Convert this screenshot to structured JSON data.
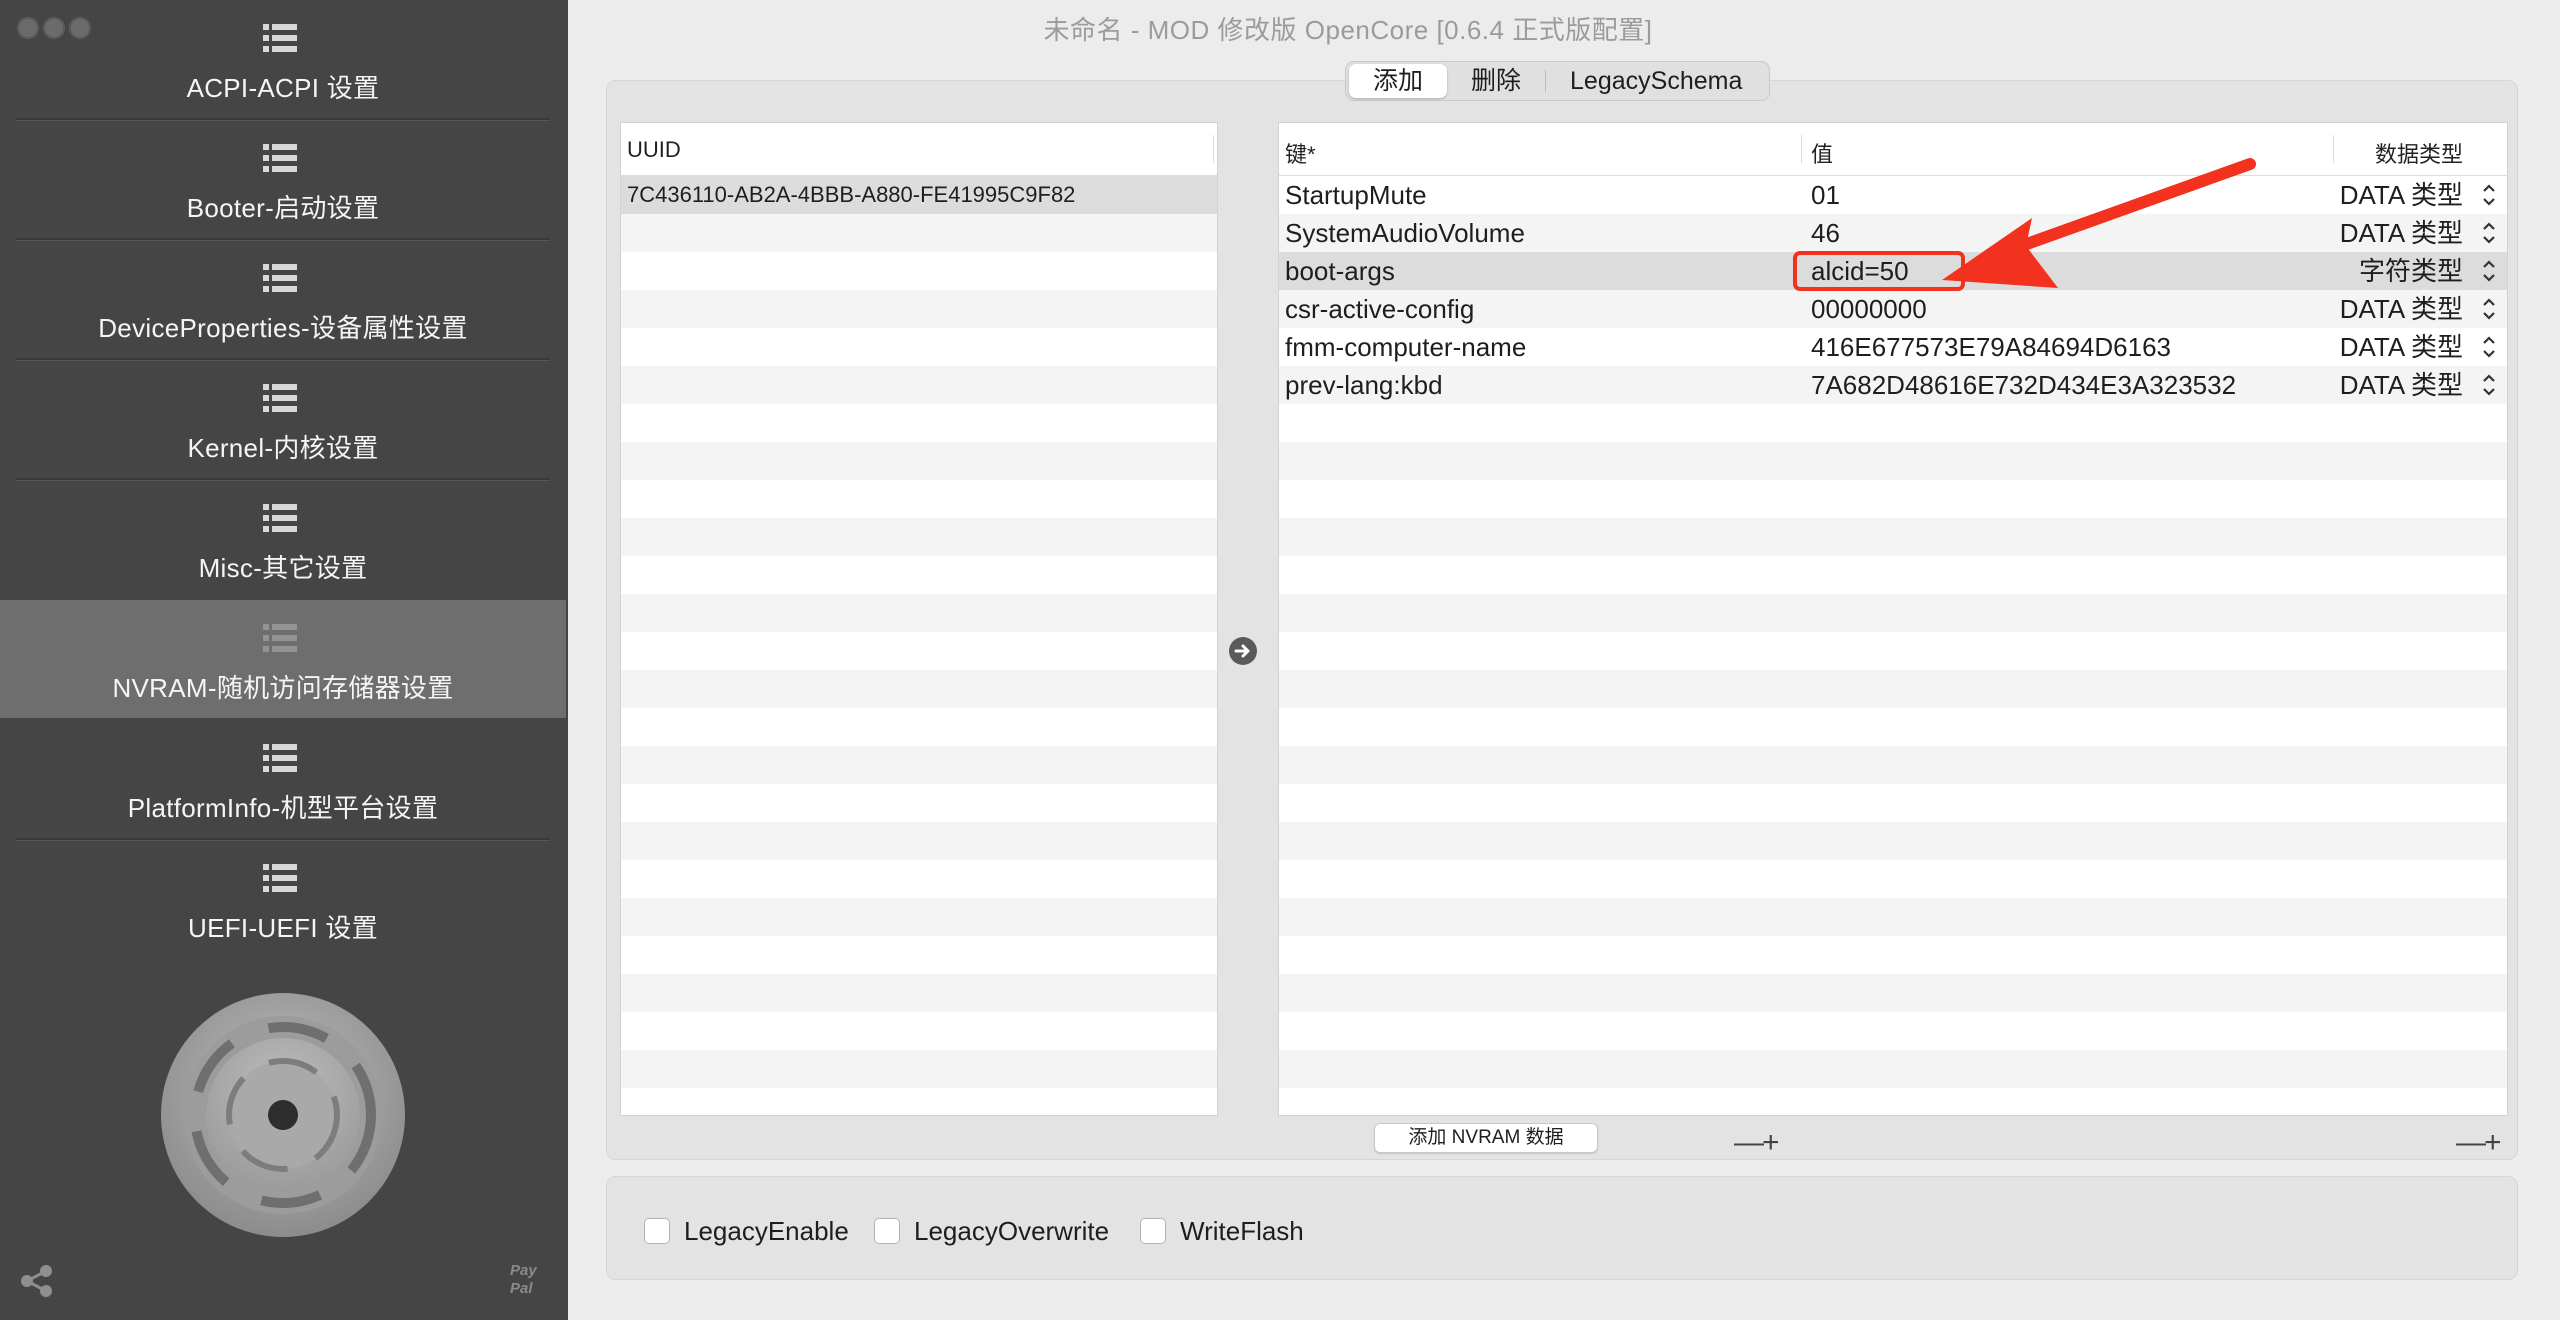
{
  "window": {
    "title": "未命名 - MOD 修改版 OpenCore [0.6.4 正式版配置]"
  },
  "sidebar": {
    "items": [
      {
        "label": "ACPI-ACPI 设置",
        "icon": "list-icon",
        "selected": false
      },
      {
        "label": "Booter-启动设置",
        "icon": "list-icon",
        "selected": false
      },
      {
        "label": "DeviceProperties-设备属性设置",
        "icon": "list-icon",
        "selected": false
      },
      {
        "label": "Kernel-内核设置",
        "icon": "list-icon",
        "selected": false
      },
      {
        "label": "Misc-其它设置",
        "icon": "list-icon",
        "selected": false
      },
      {
        "label": "NVRAM-随机访问存储器设置",
        "icon": "list-icon",
        "selected": true
      },
      {
        "label": "PlatformInfo-机型平台设置",
        "icon": "list-icon",
        "selected": false
      },
      {
        "label": "UEFI-UEFI 设置",
        "icon": "list-icon",
        "selected": false
      }
    ],
    "paypal": "Pay Pal"
  },
  "tabs": [
    {
      "label": "添加",
      "active": true
    },
    {
      "label": "删除",
      "active": false
    },
    {
      "label": "LegacySchema",
      "active": false
    }
  ],
  "uuid_table": {
    "header": "UUID",
    "rows": [
      "7C436110-AB2A-4BBB-A880-FE41995C9F82"
    ]
  },
  "nvram_table": {
    "headers": {
      "key": "键*",
      "value": "值",
      "type": "数据类型"
    },
    "rows": [
      {
        "key": "StartupMute",
        "value": "01",
        "type": "DATA 类型"
      },
      {
        "key": "SystemAudioVolume",
        "value": "46",
        "type": "DATA 类型"
      },
      {
        "key": "boot-args",
        "value": "alcid=50",
        "type": "字符类型"
      },
      {
        "key": "csr-active-config",
        "value": "00000000",
        "type": "DATA 类型"
      },
      {
        "key": "fmm-computer-name",
        "value": "416E677573E79A84694D6163",
        "type": "DATA 类型"
      },
      {
        "key": "prev-lang:kbd",
        "value": "7A682D48616E732D434E3A323532",
        "type": "DATA 类型"
      }
    ],
    "selected_row": 2
  },
  "buttons": {
    "add_nvram": "添加 NVRAM 数据",
    "minus": "—",
    "plus": "+"
  },
  "options": [
    {
      "label": "LegacyEnable",
      "checked": false
    },
    {
      "label": "LegacyOverwrite",
      "checked": false
    },
    {
      "label": "WriteFlash",
      "checked": false
    }
  ],
  "colors": {
    "highlight": "#f2321e",
    "sidebar": "#454545",
    "sidebar_selected": "#6e6e6e"
  }
}
